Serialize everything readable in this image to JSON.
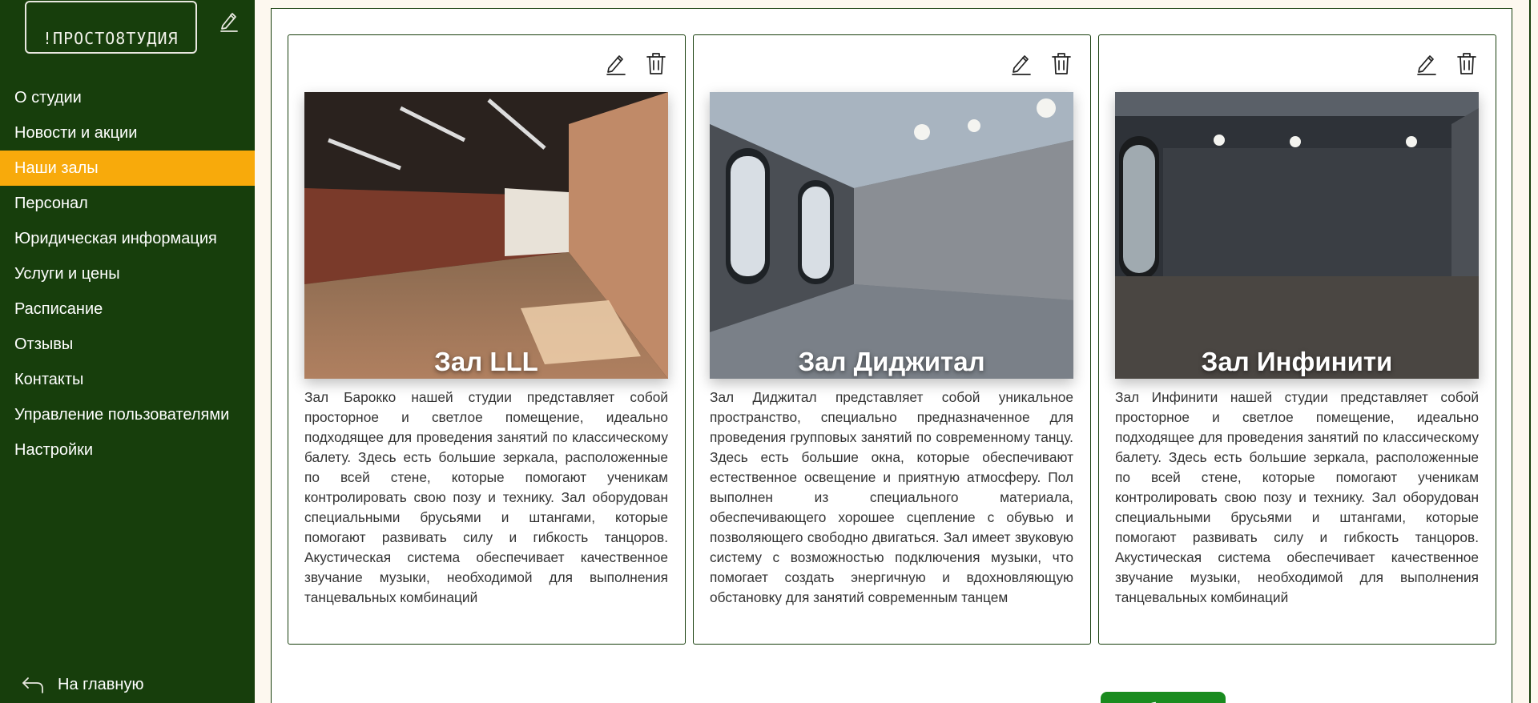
{
  "sidebar": {
    "logo_text": "!ПРОСТО8ТУДИЯ",
    "nav": [
      {
        "label": "О студии"
      },
      {
        "label": "Новости и акции"
      },
      {
        "label": "Наши залы"
      },
      {
        "label": "Персонал"
      },
      {
        "label": "Юридическая информация"
      },
      {
        "label": "Услуги и цены"
      },
      {
        "label": "Расписание"
      },
      {
        "label": "Отзывы"
      },
      {
        "label": "Контакты"
      },
      {
        "label": "Управление пользователями"
      },
      {
        "label": "Настройки"
      }
    ],
    "active_item": "Наши залы",
    "home_label": "На главную"
  },
  "halls": [
    {
      "title": "Зал LLL",
      "description": "Зал Барокко нашей студии представляет собой просторное и светлое помещение, идеально подходящее для проведения занятий по классическому балету. Здесь есть большие зеркала, расположенные по всей стене, которые помогают ученикам контролировать свою позу и технику. Зал оборудован специальными брусьями и штангами, которые помогают развивать силу и гибкость танцоров. Акустическая система обеспечивает качественное звучание музыки, необходимой для выполнения танцевальных комбинаций"
    },
    {
      "title": "Зал Диджитал",
      "description": "Зал Диджитал представляет собой уникальное пространство, специально предназначенное для проведения групповых занятий по современному танцу. Здесь есть большие окна, которые обеспечивают естественное освещение и приятную атмосферу. Пол выполнен из специального материала, обеспечивающего хорошее сцепление с обувью и позволяющего свободно двигаться. Зал имеет звуковую систему с возможностью подключения музыки, что помогает создать энергичную и вдохновляющую обстановку для занятий современным танцем"
    },
    {
      "title": "Зал Инфинити",
      "description": "Зал Инфинити нашей студии представляет собой просторное и светлое помещение, идеально подходящее для проведения занятий по классическому балету. Здесь есть большие зеркала, расположенные по всей стене, которые помогают ученикам контролировать свою позу и технику. Зал оборудован специальными брусьями и штангами, которые помогают развивать силу и гибкость танцоров. Акустическая система обеспечивает качественное звучание музыки, необходимой для выполнения танцевальных комбинаций"
    }
  ],
  "add_button_label": "Добавить",
  "colors": {
    "sidebar_bg": "#173e0c",
    "active_item": "#f8aa0b",
    "add_button": "#1a8b1f",
    "page_bg": "#fdf8ef"
  },
  "icons": {
    "edit": "pencil-icon",
    "delete": "trash-icon",
    "back": "back-arrow-icon"
  }
}
